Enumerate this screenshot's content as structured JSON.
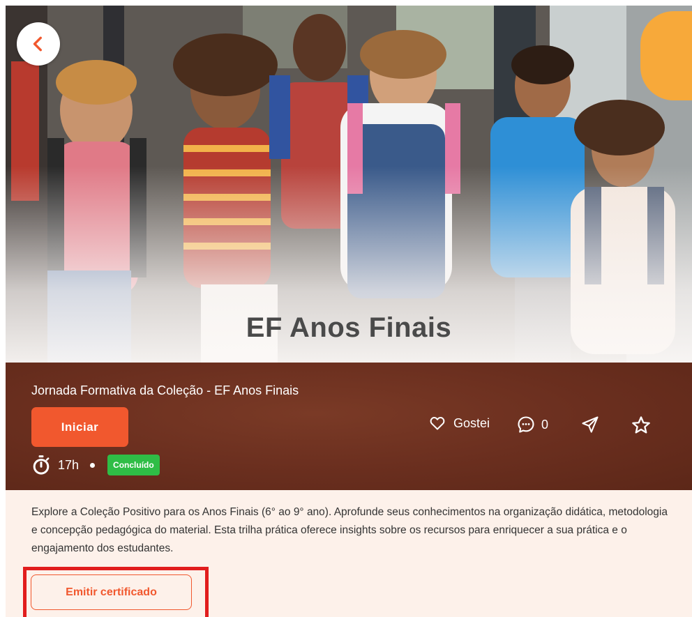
{
  "hero": {
    "banner_title": "EF Anos Finais"
  },
  "course": {
    "title": "Jornada Formativa da Coleção - EF Anos Finais",
    "start_label": "Iniciar",
    "like_label": "Gostei",
    "comments_count": "0",
    "duration": "17h",
    "status_badge": "Concluído",
    "description": "Explore a Coleção Positivo para os Anos Finais (6° ao 9° ano). Aprofunde seus conhecimentos na organização didática, metodologia e concepção pedagógica do material. Esta trilha prática oferece insights sobre os recursos para enriquecer a sua prática e o engajamento dos estudantes.",
    "certificate_label": "Emitir certificado"
  },
  "icons": {
    "back": "chevron-left-icon",
    "like": "heart-icon",
    "comments": "comment-bubble-icon",
    "share": "send-icon",
    "favorite": "star-icon",
    "duration": "stopwatch-icon"
  },
  "colors": {
    "accent": "#f1582e",
    "bar_background": "#6b2f1f",
    "status_green": "#2fbd46",
    "page_background": "#fdf1ea",
    "highlight_red": "#e11d1d"
  }
}
